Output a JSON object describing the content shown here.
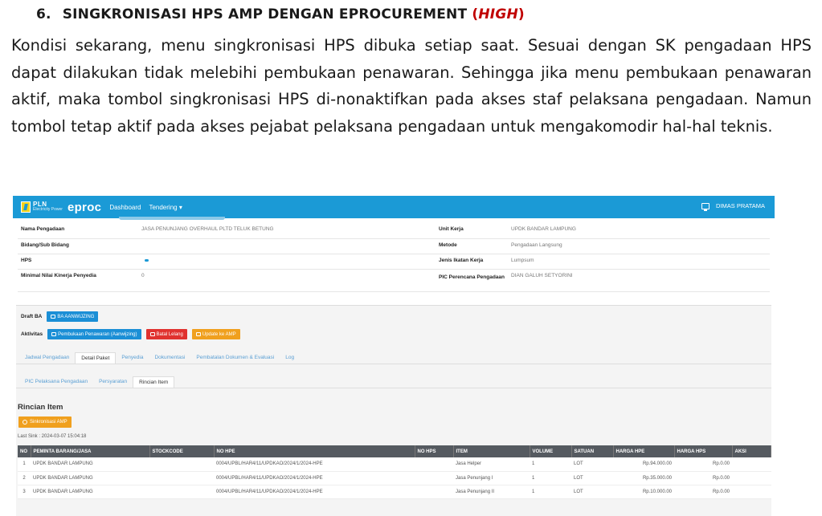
{
  "doc": {
    "number": "6.",
    "heading": "SINGKRONISASI HPS AMP DENGAN EPROCUREMENT",
    "paren_open": "(",
    "priority": "HIGH",
    "paren_close": ")",
    "paragraph": "Kondisi sekarang, menu singkronisasi HPS dibuka setiap saat. Sesuai dengan SK pengadaan HPS dapat dilakukan tidak melebihi pembukaan penawaran. Sehingga jika menu pembukaan penawaran aktif, maka tombol singkronisasi HPS di-nonaktifkan pada akses staf pelaksana pengadaan. Namun tombol tetap aktif pada akses pejabat pelaksana pengadaan untuk mengakomodir hal-hal teknis."
  },
  "app": {
    "logo_text": "PLN",
    "logo_sub": "Electricity Power",
    "brand": "eproc",
    "nav": [
      "Dashboard",
      "Tendering"
    ],
    "user": "DIMAS PRATAMA",
    "colors": {
      "topbar": "#1b9ad6",
      "accent_orange": "#f0a01e",
      "accent_red": "#e0322f"
    }
  },
  "info": {
    "rows": [
      {
        "k1": "Nama Pengadaan",
        "v1": "JASA PENUNJANG OVERHAUL PLTD TELUK BETUNG",
        "k2": "Unit Kerja",
        "v2": "UPDK BANDAR LAMPUNG"
      },
      {
        "k1": "Bidang/Sub Bidang",
        "v1": "",
        "k2": "Metode",
        "v2": "Pengadaan Langsung"
      },
      {
        "k1": "HPS",
        "v1": "",
        "k2": "Jenis Ikatan Kerja",
        "v2": "Lumpsum"
      },
      {
        "k1": "Minimal Nilai Kinerja Penyedia",
        "v1": "0",
        "k2": "PIC Perencana Pengadaan",
        "v2": "DIAN GALUH SETYORINI"
      }
    ]
  },
  "actions": {
    "draft_label": "Draft BA",
    "draft_button": "BA AANWIJZING",
    "activity_label": "Aktivitas",
    "activity_buttons": [
      "Pembukaan Penawaran (Aanwijzing)",
      "Batal Lelang",
      "Update ke AMP"
    ]
  },
  "tabs_row1": [
    "Jadwal Pengadaan",
    "Detail Paket",
    "Penyedia",
    "Dokumentasi",
    "Pembatalan Dokumen & Evaluasi",
    "Log"
  ],
  "tabs_row1_active": 1,
  "tabs_row2": [
    "PIC Pelaksana Pengadaan",
    "Persyaratan",
    "Rincian Item"
  ],
  "tabs_row2_active": 2,
  "rincian": {
    "title": "Rincian Item",
    "sync_button": "Sinkronisasi AMP",
    "last_sync": "Last Sink : 2024-03-07 15:04:18",
    "columns": [
      "NO",
      "PEMINTA BARANG/JASA",
      "STOCKCODE",
      "NO HPE",
      "NO HPS",
      "ITEM",
      "VOLUME",
      "SATUAN",
      "HARGA HPE",
      "HARGA HPS",
      "AKSI"
    ],
    "rows": [
      [
        "1",
        "UPDK BANDAR LAMPUNG",
        "",
        "0004/UPBL/HAR4/11/UPDKAO/2024/1/2024-HPE",
        "",
        "Jasa Helper",
        "1",
        "LOT",
        "Rp.94.000.00",
        "Rp.0.00",
        ""
      ],
      [
        "2",
        "UPDK BANDAR LAMPUNG",
        "",
        "0004/UPBL/HAR4/11/UPDKAO/2024/1/2024-HPE",
        "",
        "Jasa Penunjang I",
        "1",
        "LOT",
        "Rp.35.000.00",
        "Rp.0.00",
        ""
      ],
      [
        "3",
        "UPDK BANDAR LAMPUNG",
        "",
        "0004/UPBL/HAR4/11/UPDKAO/2024/1/2024-HPE",
        "",
        "Jasa Penunjang II",
        "1",
        "LOT",
        "Rp.10.000.00",
        "Rp.0.00",
        ""
      ]
    ]
  }
}
